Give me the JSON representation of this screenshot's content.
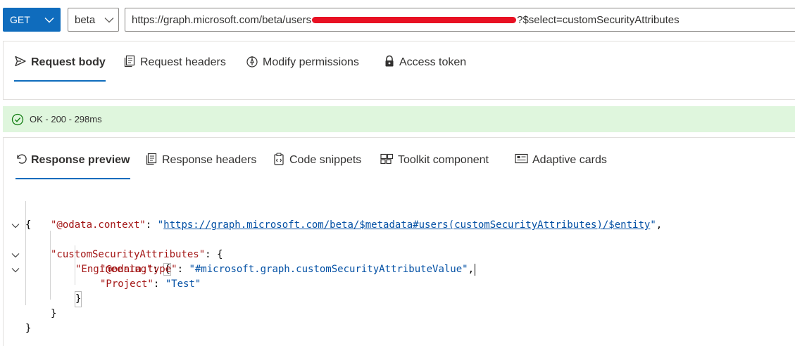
{
  "toolbar": {
    "method": "GET",
    "version": "beta",
    "url_prefix": "https://graph.microsoft.com/beta/users",
    "url_suffix": "?$select=customSecurityAttributes"
  },
  "request": {
    "tabs": [
      {
        "label": "Request body",
        "icon": "send-icon",
        "active": true
      },
      {
        "label": "Request headers",
        "icon": "headers-icon",
        "active": false
      },
      {
        "label": "Modify permissions",
        "icon": "permissions-icon",
        "active": false
      },
      {
        "label": "Access token",
        "icon": "lock-icon",
        "active": false
      }
    ]
  },
  "status": {
    "text": "OK - 200 - 298ms",
    "color": "#dff6dd",
    "icon": "check-circle-icon"
  },
  "response": {
    "tabs": [
      {
        "label": "Response preview",
        "icon": "undo-icon",
        "active": true
      },
      {
        "label": "Response headers",
        "icon": "headers-icon",
        "active": false
      },
      {
        "label": "Code snippets",
        "icon": "clipboard-icon",
        "active": false
      },
      {
        "label": "Toolkit component",
        "icon": "toolkit-icon",
        "active": false
      },
      {
        "label": "Adaptive cards",
        "icon": "card-icon",
        "active": false
      }
    ],
    "code": {
      "open_brace": "{",
      "close_brace": "}",
      "odata_context_key": "\"@odata.context\"",
      "odata_context_value": "https://graph.microsoft.com/beta/$metadata#users(customSecurityAttributes)/$entity",
      "csa_key": "\"customSecurityAttributes\"",
      "engineering_key": "\"Engineering\"",
      "odata_type_key": "\"@odata.type\"",
      "odata_type_value": "\"#microsoft.graph.customSecurityAttributeValue\"",
      "project_key": "\"Project\"",
      "project_value": "\"Test\"",
      "colon": ": ",
      "comma": ","
    }
  },
  "colors": {
    "accent": "#0f6cbd",
    "json_key": "#a31515",
    "json_string": "#0451a5",
    "redaction": "#e81123"
  }
}
